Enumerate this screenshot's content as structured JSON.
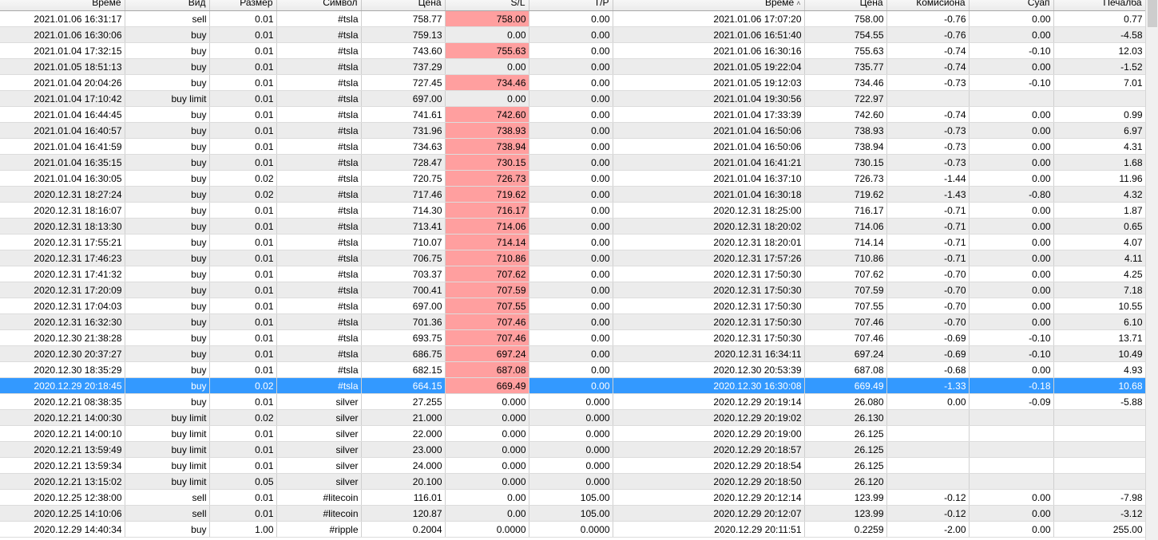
{
  "columns": [
    "Време",
    "Вид",
    "Размер",
    "Символ",
    "Цена",
    "S/L",
    "T/P",
    "Време",
    "Цена",
    "Комисиона",
    "Суап",
    "Печалба"
  ],
  "sorted_column_index": 7,
  "sort_indicator": "˄",
  "selected_row_index": 23,
  "sl_highlight_color": "#ff9f9f",
  "selection_color": "#3399ff",
  "rows": [
    {
      "cells": [
        "2021.01.06 16:31:17",
        "sell",
        "0.01",
        "#tsla",
        "758.77",
        "758.00",
        "0.00",
        "2021.01.06 17:07:20",
        "758.00",
        "-0.76",
        "0.00",
        "0.77"
      ],
      "sl_hit": true
    },
    {
      "cells": [
        "2021.01.06 16:30:06",
        "buy",
        "0.01",
        "#tsla",
        "759.13",
        "0.00",
        "0.00",
        "2021.01.06 16:51:40",
        "754.55",
        "-0.76",
        "0.00",
        "-4.58"
      ],
      "sl_hit": false
    },
    {
      "cells": [
        "2021.01.04 17:32:15",
        "buy",
        "0.01",
        "#tsla",
        "743.60",
        "755.63",
        "0.00",
        "2021.01.06 16:30:16",
        "755.63",
        "-0.74",
        "-0.10",
        "12.03"
      ],
      "sl_hit": true
    },
    {
      "cells": [
        "2021.01.05 18:51:13",
        "buy",
        "0.01",
        "#tsla",
        "737.29",
        "0.00",
        "0.00",
        "2021.01.05 19:22:04",
        "735.77",
        "-0.74",
        "0.00",
        "-1.52"
      ],
      "sl_hit": false
    },
    {
      "cells": [
        "2021.01.04 20:04:26",
        "buy",
        "0.01",
        "#tsla",
        "727.45",
        "734.46",
        "0.00",
        "2021.01.05 19:12:03",
        "734.46",
        "-0.73",
        "-0.10",
        "7.01"
      ],
      "sl_hit": true
    },
    {
      "cells": [
        "2021.01.04 17:10:42",
        "buy limit",
        "0.01",
        "#tsla",
        "697.00",
        "0.00",
        "0.00",
        "2021.01.04 19:30:56",
        "722.97",
        "",
        "",
        ""
      ],
      "sl_hit": false
    },
    {
      "cells": [
        "2021.01.04 16:44:45",
        "buy",
        "0.01",
        "#tsla",
        "741.61",
        "742.60",
        "0.00",
        "2021.01.04 17:33:39",
        "742.60",
        "-0.74",
        "0.00",
        "0.99"
      ],
      "sl_hit": true
    },
    {
      "cells": [
        "2021.01.04 16:40:57",
        "buy",
        "0.01",
        "#tsla",
        "731.96",
        "738.93",
        "0.00",
        "2021.01.04 16:50:06",
        "738.93",
        "-0.73",
        "0.00",
        "6.97"
      ],
      "sl_hit": true
    },
    {
      "cells": [
        "2021.01.04 16:41:59",
        "buy",
        "0.01",
        "#tsla",
        "734.63",
        "738.94",
        "0.00",
        "2021.01.04 16:50:06",
        "738.94",
        "-0.73",
        "0.00",
        "4.31"
      ],
      "sl_hit": true
    },
    {
      "cells": [
        "2021.01.04 16:35:15",
        "buy",
        "0.01",
        "#tsla",
        "728.47",
        "730.15",
        "0.00",
        "2021.01.04 16:41:21",
        "730.15",
        "-0.73",
        "0.00",
        "1.68"
      ],
      "sl_hit": true
    },
    {
      "cells": [
        "2021.01.04 16:30:05",
        "buy",
        "0.02",
        "#tsla",
        "720.75",
        "726.73",
        "0.00",
        "2021.01.04 16:37:10",
        "726.73",
        "-1.44",
        "0.00",
        "11.96"
      ],
      "sl_hit": true
    },
    {
      "cells": [
        "2020.12.31 18:27:24",
        "buy",
        "0.02",
        "#tsla",
        "717.46",
        "719.62",
        "0.00",
        "2021.01.04 16:30:18",
        "719.62",
        "-1.43",
        "-0.80",
        "4.32"
      ],
      "sl_hit": true
    },
    {
      "cells": [
        "2020.12.31 18:16:07",
        "buy",
        "0.01",
        "#tsla",
        "714.30",
        "716.17",
        "0.00",
        "2020.12.31 18:25:00",
        "716.17",
        "-0.71",
        "0.00",
        "1.87"
      ],
      "sl_hit": true
    },
    {
      "cells": [
        "2020.12.31 18:13:30",
        "buy",
        "0.01",
        "#tsla",
        "713.41",
        "714.06",
        "0.00",
        "2020.12.31 18:20:02",
        "714.06",
        "-0.71",
        "0.00",
        "0.65"
      ],
      "sl_hit": true
    },
    {
      "cells": [
        "2020.12.31 17:55:21",
        "buy",
        "0.01",
        "#tsla",
        "710.07",
        "714.14",
        "0.00",
        "2020.12.31 18:20:01",
        "714.14",
        "-0.71",
        "0.00",
        "4.07"
      ],
      "sl_hit": true
    },
    {
      "cells": [
        "2020.12.31 17:46:23",
        "buy",
        "0.01",
        "#tsla",
        "706.75",
        "710.86",
        "0.00",
        "2020.12.31 17:57:26",
        "710.86",
        "-0.71",
        "0.00",
        "4.11"
      ],
      "sl_hit": true
    },
    {
      "cells": [
        "2020.12.31 17:41:32",
        "buy",
        "0.01",
        "#tsla",
        "703.37",
        "707.62",
        "0.00",
        "2020.12.31 17:50:30",
        "707.62",
        "-0.70",
        "0.00",
        "4.25"
      ],
      "sl_hit": true
    },
    {
      "cells": [
        "2020.12.31 17:20:09",
        "buy",
        "0.01",
        "#tsla",
        "700.41",
        "707.59",
        "0.00",
        "2020.12.31 17:50:30",
        "707.59",
        "-0.70",
        "0.00",
        "7.18"
      ],
      "sl_hit": true
    },
    {
      "cells": [
        "2020.12.31 17:04:03",
        "buy",
        "0.01",
        "#tsla",
        "697.00",
        "707.55",
        "0.00",
        "2020.12.31 17:50:30",
        "707.55",
        "-0.70",
        "0.00",
        "10.55"
      ],
      "sl_hit": true
    },
    {
      "cells": [
        "2020.12.31 16:32:30",
        "buy",
        "0.01",
        "#tsla",
        "701.36",
        "707.46",
        "0.00",
        "2020.12.31 17:50:30",
        "707.46",
        "-0.70",
        "0.00",
        "6.10"
      ],
      "sl_hit": true
    },
    {
      "cells": [
        "2020.12.30 21:38:28",
        "buy",
        "0.01",
        "#tsla",
        "693.75",
        "707.46",
        "0.00",
        "2020.12.31 17:50:30",
        "707.46",
        "-0.69",
        "-0.10",
        "13.71"
      ],
      "sl_hit": true
    },
    {
      "cells": [
        "2020.12.30 20:37:27",
        "buy",
        "0.01",
        "#tsla",
        "686.75",
        "697.24",
        "0.00",
        "2020.12.31 16:34:11",
        "697.24",
        "-0.69",
        "-0.10",
        "10.49"
      ],
      "sl_hit": true
    },
    {
      "cells": [
        "2020.12.30 18:35:29",
        "buy",
        "0.01",
        "#tsla",
        "682.15",
        "687.08",
        "0.00",
        "2020.12.30 20:53:39",
        "687.08",
        "-0.68",
        "0.00",
        "4.93"
      ],
      "sl_hit": true
    },
    {
      "cells": [
        "2020.12.29 20:18:45",
        "buy",
        "0.02",
        "#tsla",
        "664.15",
        "669.49",
        "0.00",
        "2020.12.30 16:30:08",
        "669.49",
        "-1.33",
        "-0.18",
        "10.68"
      ],
      "sl_hit": true
    },
    {
      "cells": [
        "2020.12.21 08:38:35",
        "buy",
        "0.01",
        "silver",
        "27.255",
        "0.000",
        "0.000",
        "2020.12.29 20:19:14",
        "26.080",
        "0.00",
        "-0.09",
        "-5.88"
      ],
      "sl_hit": false
    },
    {
      "cells": [
        "2020.12.21 14:00:30",
        "buy limit",
        "0.02",
        "silver",
        "21.000",
        "0.000",
        "0.000",
        "2020.12.29 20:19:02",
        "26.130",
        "",
        "",
        ""
      ],
      "sl_hit": false
    },
    {
      "cells": [
        "2020.12.21 14:00:10",
        "buy limit",
        "0.01",
        "silver",
        "22.000",
        "0.000",
        "0.000",
        "2020.12.29 20:19:00",
        "26.125",
        "",
        "",
        ""
      ],
      "sl_hit": false
    },
    {
      "cells": [
        "2020.12.21 13:59:49",
        "buy limit",
        "0.01",
        "silver",
        "23.000",
        "0.000",
        "0.000",
        "2020.12.29 20:18:57",
        "26.125",
        "",
        "",
        ""
      ],
      "sl_hit": false
    },
    {
      "cells": [
        "2020.12.21 13:59:34",
        "buy limit",
        "0.01",
        "silver",
        "24.000",
        "0.000",
        "0.000",
        "2020.12.29 20:18:54",
        "26.125",
        "",
        "",
        ""
      ],
      "sl_hit": false
    },
    {
      "cells": [
        "2020.12.21 13:15:02",
        "buy limit",
        "0.05",
        "silver",
        "20.100",
        "0.000",
        "0.000",
        "2020.12.29 20:18:50",
        "26.120",
        "",
        "",
        ""
      ],
      "sl_hit": false
    },
    {
      "cells": [
        "2020.12.25 12:38:00",
        "sell",
        "0.01",
        "#litecoin",
        "116.01",
        "0.00",
        "105.00",
        "2020.12.29 20:12:14",
        "123.99",
        "-0.12",
        "0.00",
        "-7.98"
      ],
      "sl_hit": false
    },
    {
      "cells": [
        "2020.12.25 14:10:06",
        "sell",
        "0.01",
        "#litecoin",
        "120.87",
        "0.00",
        "105.00",
        "2020.12.29 20:12:07",
        "123.99",
        "-0.12",
        "0.00",
        "-3.12"
      ],
      "sl_hit": false
    },
    {
      "cells": [
        "2020.12.29 14:40:34",
        "buy",
        "1.00",
        "#ripple",
        "0.2004",
        "0.0000",
        "0.0000",
        "2020.12.29 20:11:51",
        "0.2259",
        "-2.00",
        "0.00",
        "255.00"
      ],
      "sl_hit": false
    }
  ]
}
